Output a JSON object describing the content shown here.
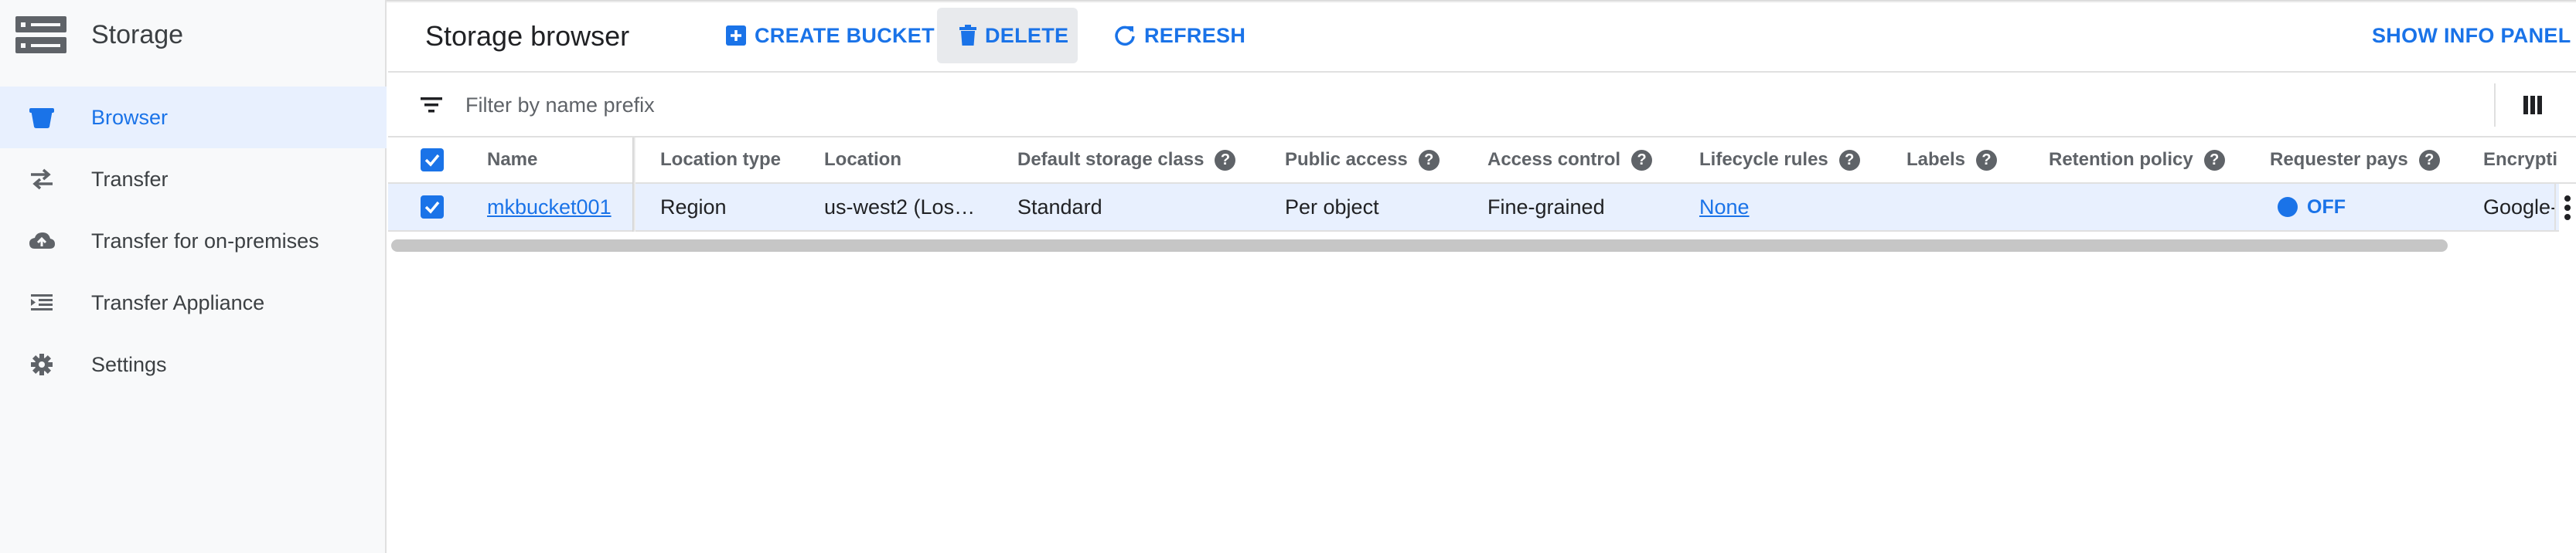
{
  "app": {
    "title": "Storage",
    "icon": "storage-icon"
  },
  "sidebar": {
    "items": [
      {
        "label": "Browser",
        "icon": "bucket-icon",
        "active": true
      },
      {
        "label": "Transfer",
        "icon": "transfer-arrows-icon",
        "active": false
      },
      {
        "label": "Transfer for on-premises",
        "icon": "cloud-upload-icon",
        "active": false
      },
      {
        "label": "Transfer Appliance",
        "icon": "list-indent-icon",
        "active": false
      },
      {
        "label": "Settings",
        "icon": "gear-icon",
        "active": false
      }
    ]
  },
  "toolbar": {
    "page_title": "Storage browser",
    "create_label": "CREATE BUCKET",
    "delete_label": "DELETE",
    "refresh_label": "REFRESH",
    "info_panel_label": "SHOW INFO PANEL"
  },
  "filter": {
    "placeholder": "Filter by name prefix",
    "value": ""
  },
  "table": {
    "columns": [
      {
        "label": "Name",
        "help": false
      },
      {
        "label": "Location type",
        "help": false
      },
      {
        "label": "Location",
        "help": false
      },
      {
        "label": "Default storage class",
        "help": true
      },
      {
        "label": "Public access",
        "help": true
      },
      {
        "label": "Access control",
        "help": true
      },
      {
        "label": "Lifecycle rules",
        "help": true
      },
      {
        "label": "Labels",
        "help": true
      },
      {
        "label": "Retention policy",
        "help": true
      },
      {
        "label": "Requester pays",
        "help": true
      },
      {
        "label": "Encrypti",
        "help": false
      }
    ],
    "help_glyph": "?",
    "rows": [
      {
        "selected": true,
        "name": "mkbucket001",
        "location_type": "Region",
        "location": "us-west2 (Los…",
        "storage_class": "Standard",
        "public_access": "Per object",
        "access_control": "Fine-grained",
        "lifecycle_rules": "None",
        "labels": "",
        "retention_policy": "",
        "requester_pays": "OFF",
        "encryption": "Google-"
      }
    ]
  },
  "colors": {
    "accent": "#1a73e8",
    "selected_row": "#e8f0fe",
    "sidebar_bg": "#f8f9fa"
  }
}
